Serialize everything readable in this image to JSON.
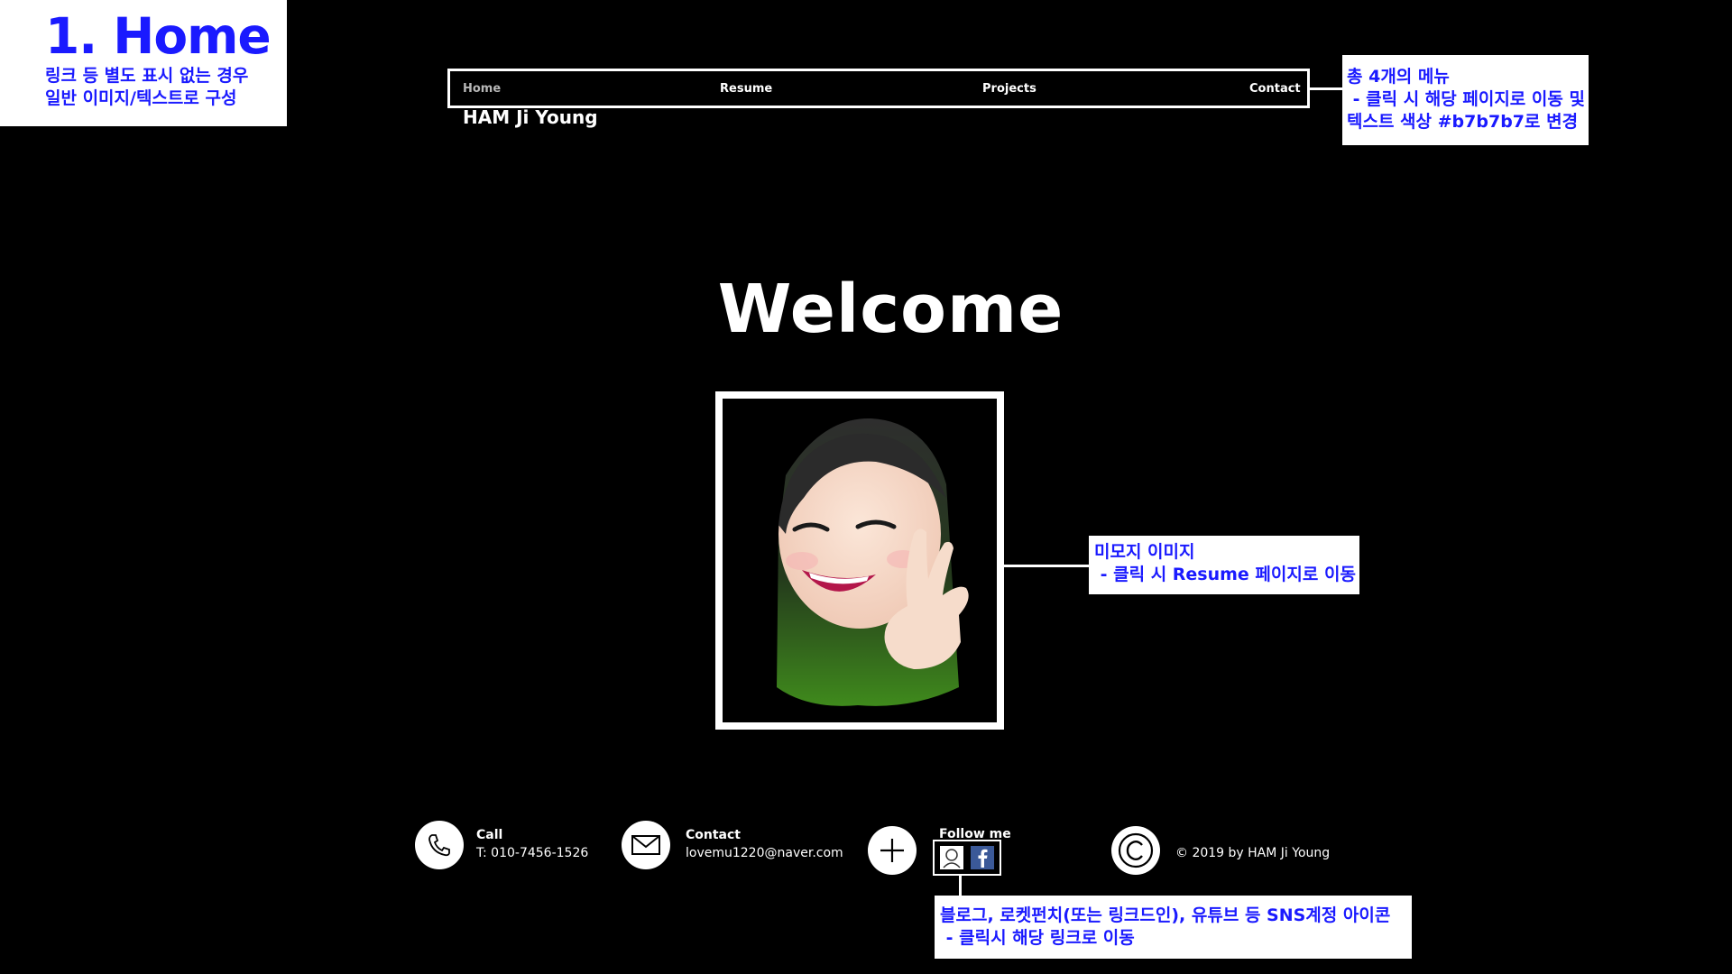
{
  "annotations": {
    "page_title": "1. Home",
    "page_note": "링크 등 별도 표시 없는 경우\n일반 이미지/텍스트로 구성",
    "menu_note": "총 4개의 메뉴\n - 클릭 시 해당 페이지로 이동 및\n텍스트 색상 #b7b7b7로 변경",
    "memoji_note": "미모지 이미지\n - 클릭 시 Resume 페이지로 이동",
    "sns_note": "블로그, 로켓펀치(또는 링크드인), 유튜브 등 SNS계정 아이콘\n - 클릭시 해당 링크로 이동",
    "text_color": "#1a1aff"
  },
  "nav": {
    "items": [
      {
        "label": "Home",
        "active": true
      },
      {
        "label": "Resume",
        "active": false
      },
      {
        "label": "Projects",
        "active": false
      },
      {
        "label": "Contact",
        "active": false
      }
    ],
    "active_color": "#b7b7b7"
  },
  "site_name": "HAM Ji Young",
  "hero": {
    "heading": "Welcome",
    "image": "memoji-portrait"
  },
  "footer": {
    "call": {
      "label": "Call",
      "value": "T: 010-7456-1526",
      "icon": "phone-icon"
    },
    "contact": {
      "label": "Contact",
      "value": "lovemu1220@naver.com",
      "icon": "mail-icon"
    },
    "follow": {
      "label": "Follow me",
      "icon": "plus-icon",
      "socials": [
        "blog-icon",
        "facebook-icon"
      ]
    },
    "copyright": {
      "text": "© 2019 by HAM Ji Young",
      "icon": "copyright-icon"
    }
  }
}
